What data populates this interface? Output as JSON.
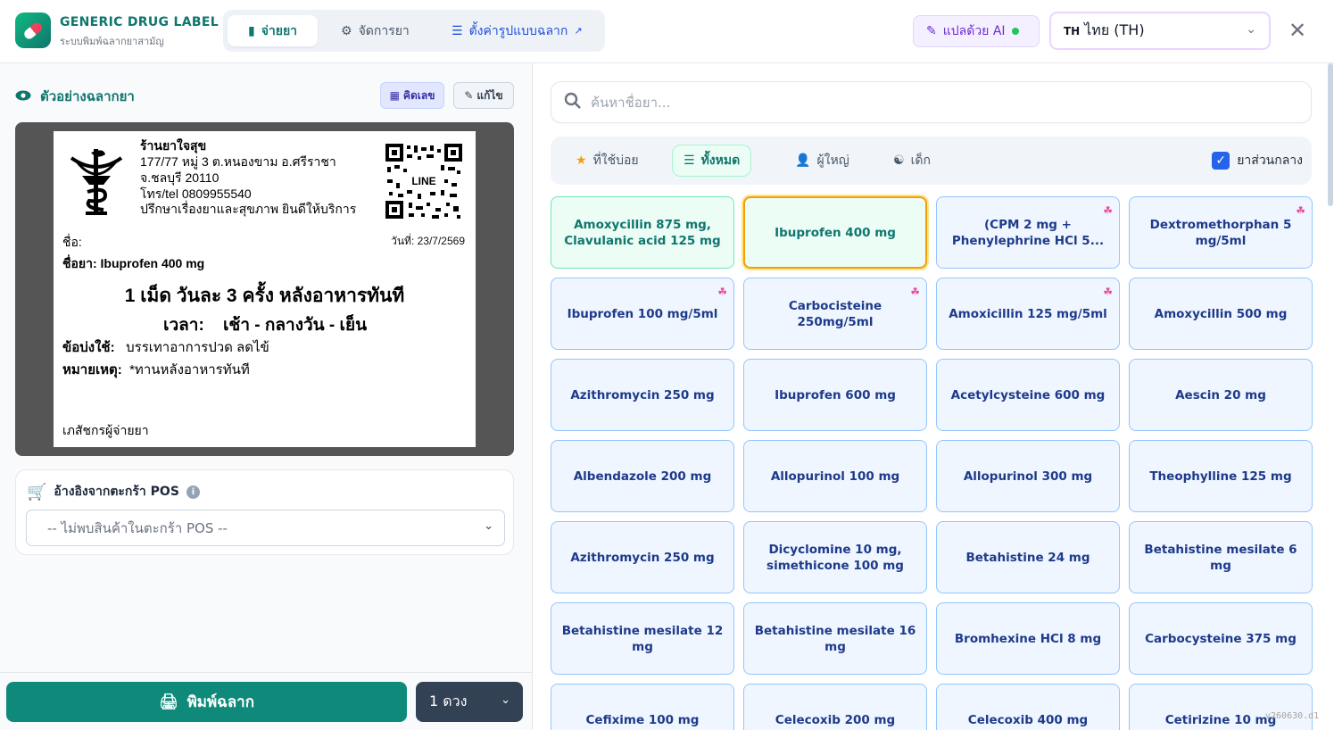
{
  "app": {
    "title": "GENERIC DRUG LABEL",
    "subtitle": "ระบบพิมพ์ฉลากยาสามัญ",
    "accent": "#0f766e"
  },
  "tabs": [
    {
      "label": "จ่ายยา",
      "icon": "bottle-icon",
      "active": true
    },
    {
      "label": "จัดการยา",
      "icon": "gear-icon",
      "active": false
    },
    {
      "label": "ตั้งค่ารูปแบบฉลาก",
      "icon": "sliders-icon",
      "active": false,
      "external": true
    }
  ],
  "ai_button": {
    "label": "แปลด้วย AI",
    "icon": "wand-icon",
    "status_color": "#22c55e"
  },
  "language": {
    "code": "TH",
    "label": "ไทย (TH)"
  },
  "preview": {
    "title": "ตัวอย่างฉลากยา",
    "calc_label": "คิดเลข",
    "edit_label": "แก้ไข"
  },
  "label": {
    "store_name": "ร้านยาใจสุข",
    "store_lines": [
      "177/77 หมู่ 3 ต.หนองขาม อ.ศรีราชา",
      "จ.ชลบุรี 20110",
      "โทร/tel 0809955540",
      "ปรึกษาเรื่องยาและสุขภาพ ยินดีให้บริการ"
    ],
    "qr_text": "LINE",
    "name_label": "ชื่อ:",
    "date": "วันที่: 23/7/2569",
    "drug": "ชื่อยา: Ibuprofen 400 mg",
    "dose": "1 เม็ด วันละ 3 ครั้ง หลังอาหารทันที",
    "time_label": "เวลา:",
    "time_value": "เช้า - กลางวัน - เย็น",
    "indication_label": "ข้อบ่งใช้:",
    "indication": "บรรเทาอาการปวด ลดไข้",
    "note_label": "หมายเหตุ:",
    "note": "*ทานหลังอาหารทันที",
    "pharmacist": "เภสัชกรผู้จ่ายยา"
  },
  "pos": {
    "title": "อ้างอิงจากตะกร้า POS",
    "select_value": "-- ไม่พบสินค้าในตะกร้า POS --"
  },
  "print": {
    "label": "พิมพ์ฉลาก",
    "qty": "1 ดวง"
  },
  "search": {
    "placeholder": "ค้นหาชื่อยา..."
  },
  "filters": [
    {
      "label": "ที่ใช้บ่อย",
      "icon": "star-icon",
      "active": false
    },
    {
      "label": "ทั้งหมด",
      "icon": "layers-icon",
      "active": true
    },
    {
      "label": "ผู้ใหญ่",
      "icon": "user-icon",
      "active": false
    },
    {
      "label": "เด็ก",
      "icon": "child-icon",
      "active": false
    }
  ],
  "center_drug": {
    "label": "ยาส่วนกลาง",
    "checked": true
  },
  "drugs": [
    {
      "name": "Amoxycillin 875 mg, Clavulanic acid 125 mg",
      "style": "green",
      "kid": false
    },
    {
      "name": "Ibuprofen 400 mg",
      "style": "selected",
      "kid": false
    },
    {
      "name": "(CPM 2 mg + Phenylephrine HCl 5...",
      "style": "blue",
      "kid": true
    },
    {
      "name": "Dextromethorphan 5 mg/5ml",
      "style": "blue",
      "kid": true
    },
    {
      "name": "Ibuprofen 100 mg/5ml",
      "style": "blue",
      "kid": true
    },
    {
      "name": "Carbocisteine 250mg/5ml",
      "style": "blue",
      "kid": true
    },
    {
      "name": "Amoxicillin 125 mg/5ml",
      "style": "blue",
      "kid": true
    },
    {
      "name": "Amoxycillin 500 mg",
      "style": "blue",
      "kid": false
    },
    {
      "name": "Azithromycin 250 mg",
      "style": "blue",
      "kid": false
    },
    {
      "name": "Ibuprofen 600 mg",
      "style": "blue",
      "kid": false
    },
    {
      "name": "Acetylcysteine 600 mg",
      "style": "blue",
      "kid": false
    },
    {
      "name": "Aescin 20 mg",
      "style": "blue",
      "kid": false
    },
    {
      "name": "Albendazole 200 mg",
      "style": "blue",
      "kid": false
    },
    {
      "name": "Allopurinol 100 mg",
      "style": "blue",
      "kid": false
    },
    {
      "name": "Allopurinol 300 mg",
      "style": "blue",
      "kid": false
    },
    {
      "name": "Theophylline 125 mg",
      "style": "blue",
      "kid": false
    },
    {
      "name": "Azithromycin 250 mg",
      "style": "blue",
      "kid": false
    },
    {
      "name": "Dicyclomine 10 mg, simethicone 100 mg",
      "style": "blue",
      "kid": false
    },
    {
      "name": "Betahistine 24 mg",
      "style": "blue",
      "kid": false
    },
    {
      "name": "Betahistine mesilate 6 mg",
      "style": "blue",
      "kid": false
    },
    {
      "name": "Betahistine mesilate 12 mg",
      "style": "blue",
      "kid": false
    },
    {
      "name": "Betahistine mesilate 16 mg",
      "style": "blue",
      "kid": false
    },
    {
      "name": "Bromhexine HCl 8 mg",
      "style": "blue",
      "kid": false
    },
    {
      "name": "Carbocysteine 375 mg",
      "style": "blue",
      "kid": false
    },
    {
      "name": "Cefixime 100 mg",
      "style": "blue",
      "kid": false
    },
    {
      "name": "Celecoxib 200 mg",
      "style": "blue",
      "kid": false
    },
    {
      "name": "Celecoxib 400 mg",
      "style": "blue",
      "kid": false
    },
    {
      "name": "Cetirizine 10 mg",
      "style": "blue",
      "kid": false
    }
  ],
  "version": "v260630.d1"
}
